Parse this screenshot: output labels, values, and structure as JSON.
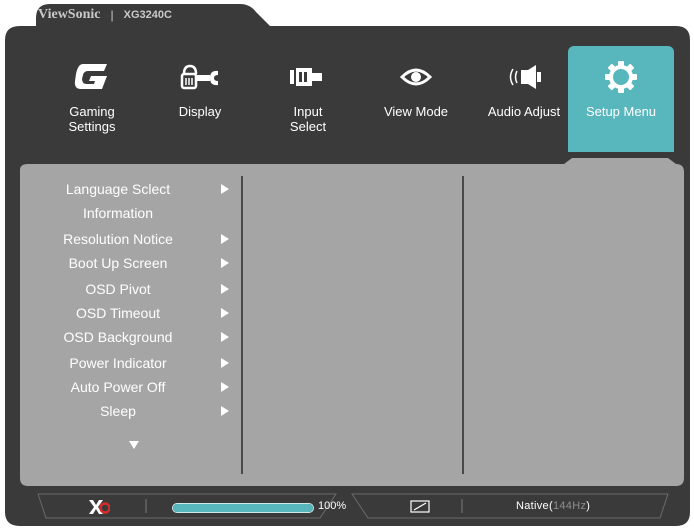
{
  "header": {
    "brand": "ViewSonic",
    "separator": "|",
    "model": "XG3240C"
  },
  "tabs": [
    {
      "label": "Gaming\nSettings",
      "icon": "gaming-g-icon",
      "active": false
    },
    {
      "label": "Display",
      "icon": "display-tools-icon",
      "active": false
    },
    {
      "label": "Input\nSelect",
      "icon": "input-plug-icon",
      "active": false
    },
    {
      "label": "View Mode",
      "icon": "eye-icon",
      "active": false
    },
    {
      "label": "Audio Adjust",
      "icon": "speaker-icon",
      "active": false
    },
    {
      "label": "Setup Menu",
      "icon": "gear-icon",
      "active": true
    }
  ],
  "menu": {
    "items": [
      {
        "label": "Language Sclect",
        "has_arrow": true
      },
      {
        "label": "Information",
        "has_arrow": false
      },
      {
        "label": "Resolution Notice",
        "has_arrow": true
      },
      {
        "label": "Boot Up Screen",
        "has_arrow": true
      },
      {
        "label": "OSD Pivot",
        "has_arrow": true
      },
      {
        "label": "OSD Timeout",
        "has_arrow": true
      },
      {
        "label": "OSD Background",
        "has_arrow": true
      },
      {
        "label": "Power Indicator",
        "has_arrow": true
      },
      {
        "label": "Auto Power Off",
        "has_arrow": true
      },
      {
        "label": "Sleep",
        "has_arrow": true
      }
    ],
    "more_icon": "triangle-down-icon"
  },
  "status": {
    "logo": "XG",
    "progress": 1.0,
    "progress_label": "100%",
    "aspect_icon": "aspect-ratio-icon",
    "resolution_prefix": "Native(",
    "refresh": "144Hz",
    "resolution_suffix": ")"
  },
  "colors": {
    "accent": "#58b6bd",
    "frame_dark": "#3a3a3a",
    "panel_gray": "#a3a3a3",
    "logo_red": "#d42b2b"
  }
}
